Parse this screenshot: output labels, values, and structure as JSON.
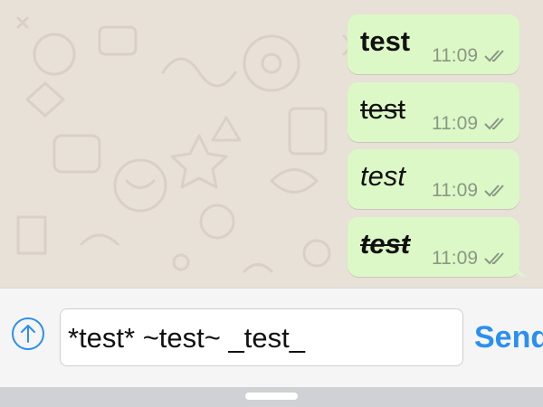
{
  "messages": [
    {
      "text": "test",
      "style": "bold",
      "time": "11:09",
      "status": "read"
    },
    {
      "text": "test",
      "style": "strikethrough",
      "time": "11:09",
      "status": "read"
    },
    {
      "text": "test",
      "style": "italic",
      "time": "11:09",
      "status": "read"
    },
    {
      "text": "test",
      "style": "bold-italic-strikethrough",
      "time": "11:09",
      "status": "read"
    }
  ],
  "composer": {
    "input_value": "*test* ~test~ _test_",
    "send_label": "Send",
    "attach_icon": "upload-arrow-icon"
  },
  "colors": {
    "outgoing_bubble": "#dcf8c6",
    "accent": "#2b8ff0",
    "chat_background": "#e8e1d8",
    "ticks": "#8a9786"
  }
}
